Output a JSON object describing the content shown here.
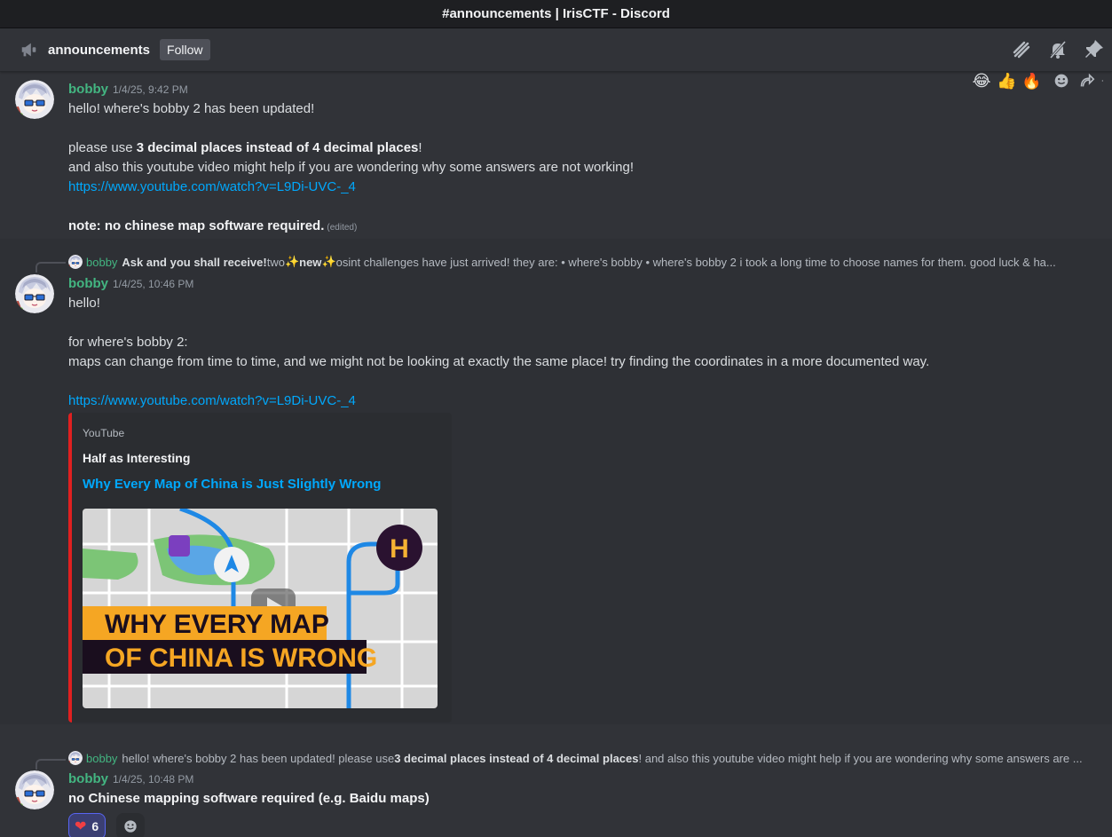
{
  "window": {
    "title": "#announcements | IrisCTF - Discord"
  },
  "channel": {
    "name": "announcements",
    "follow_label": "Follow"
  },
  "header_tools": {
    "icons": [
      "threads-icon",
      "mute-bell-icon",
      "pin-icon"
    ]
  },
  "hover_bar": {
    "emojis": [
      "😂",
      "👍",
      "🔥"
    ],
    "icons": [
      "add-reaction-icon",
      "reply-icon",
      "more-icon"
    ]
  },
  "messages": [
    {
      "author": "bobby",
      "timestamp": "1/4/25, 9:42 PM",
      "line1": "hello! where's bobby 2 has been updated!",
      "line2_pre": "please use ",
      "line2_bold": "3 decimal places instead of 4 decimal places",
      "line2_post": "!",
      "line3": "and also this youtube video might help if you are wondering why some answers are not working!",
      "link": "https://www.youtube.com/watch?v=L9Di-UVC-_4",
      "note": "note: no chinese map software required.",
      "edited": "(edited)"
    },
    {
      "reply": {
        "author": "bobby",
        "bold": "Ask and you shall receive!",
        "text_a": " two ",
        "sparkle": "✨",
        "new_word": "new",
        "text_b": " osint challenges have just arrived! they are: • where's bobby  • where's bobby 2     i took a long time to choose names for them. good luck & ha..."
      },
      "author": "bobby",
      "timestamp": "1/4/25, 10:46 PM",
      "line1": "hello!",
      "line2": "for where's bobby 2:",
      "line3": "maps can change from time to time, and we might not be looking at exactly the same place! try finding the coordinates in a more documented way.",
      "link": "https://www.youtube.com/watch?v=L9Di-UVC-_4",
      "embed": {
        "provider": "YouTube",
        "author": "Half as Interesting",
        "title": "Why Every Map of China is Just Slightly Wrong",
        "thumb_line1": "WHY EVERY MAP",
        "thumb_line2": "OF CHINA IS WRONG",
        "accent": "#e02020"
      }
    },
    {
      "reply": {
        "author": "bobby",
        "text_a": "hello! where's bobby 2 has been updated!  please use ",
        "bold": "3 decimal places instead of 4 decimal places",
        "text_b": "! and also this youtube video might help if you are wondering why some answers are ..."
      },
      "author": "bobby",
      "timestamp": "1/4/25, 10:48 PM",
      "line1": "no Chinese mapping software required (e.g. Baidu maps)",
      "reactions": [
        {
          "emoji": "❤",
          "count": "6",
          "active": true
        }
      ]
    }
  ],
  "colors": {
    "username": "#43b581",
    "link": "#00a8fc",
    "background": "#313338",
    "titlebar": "#1e1f22"
  }
}
